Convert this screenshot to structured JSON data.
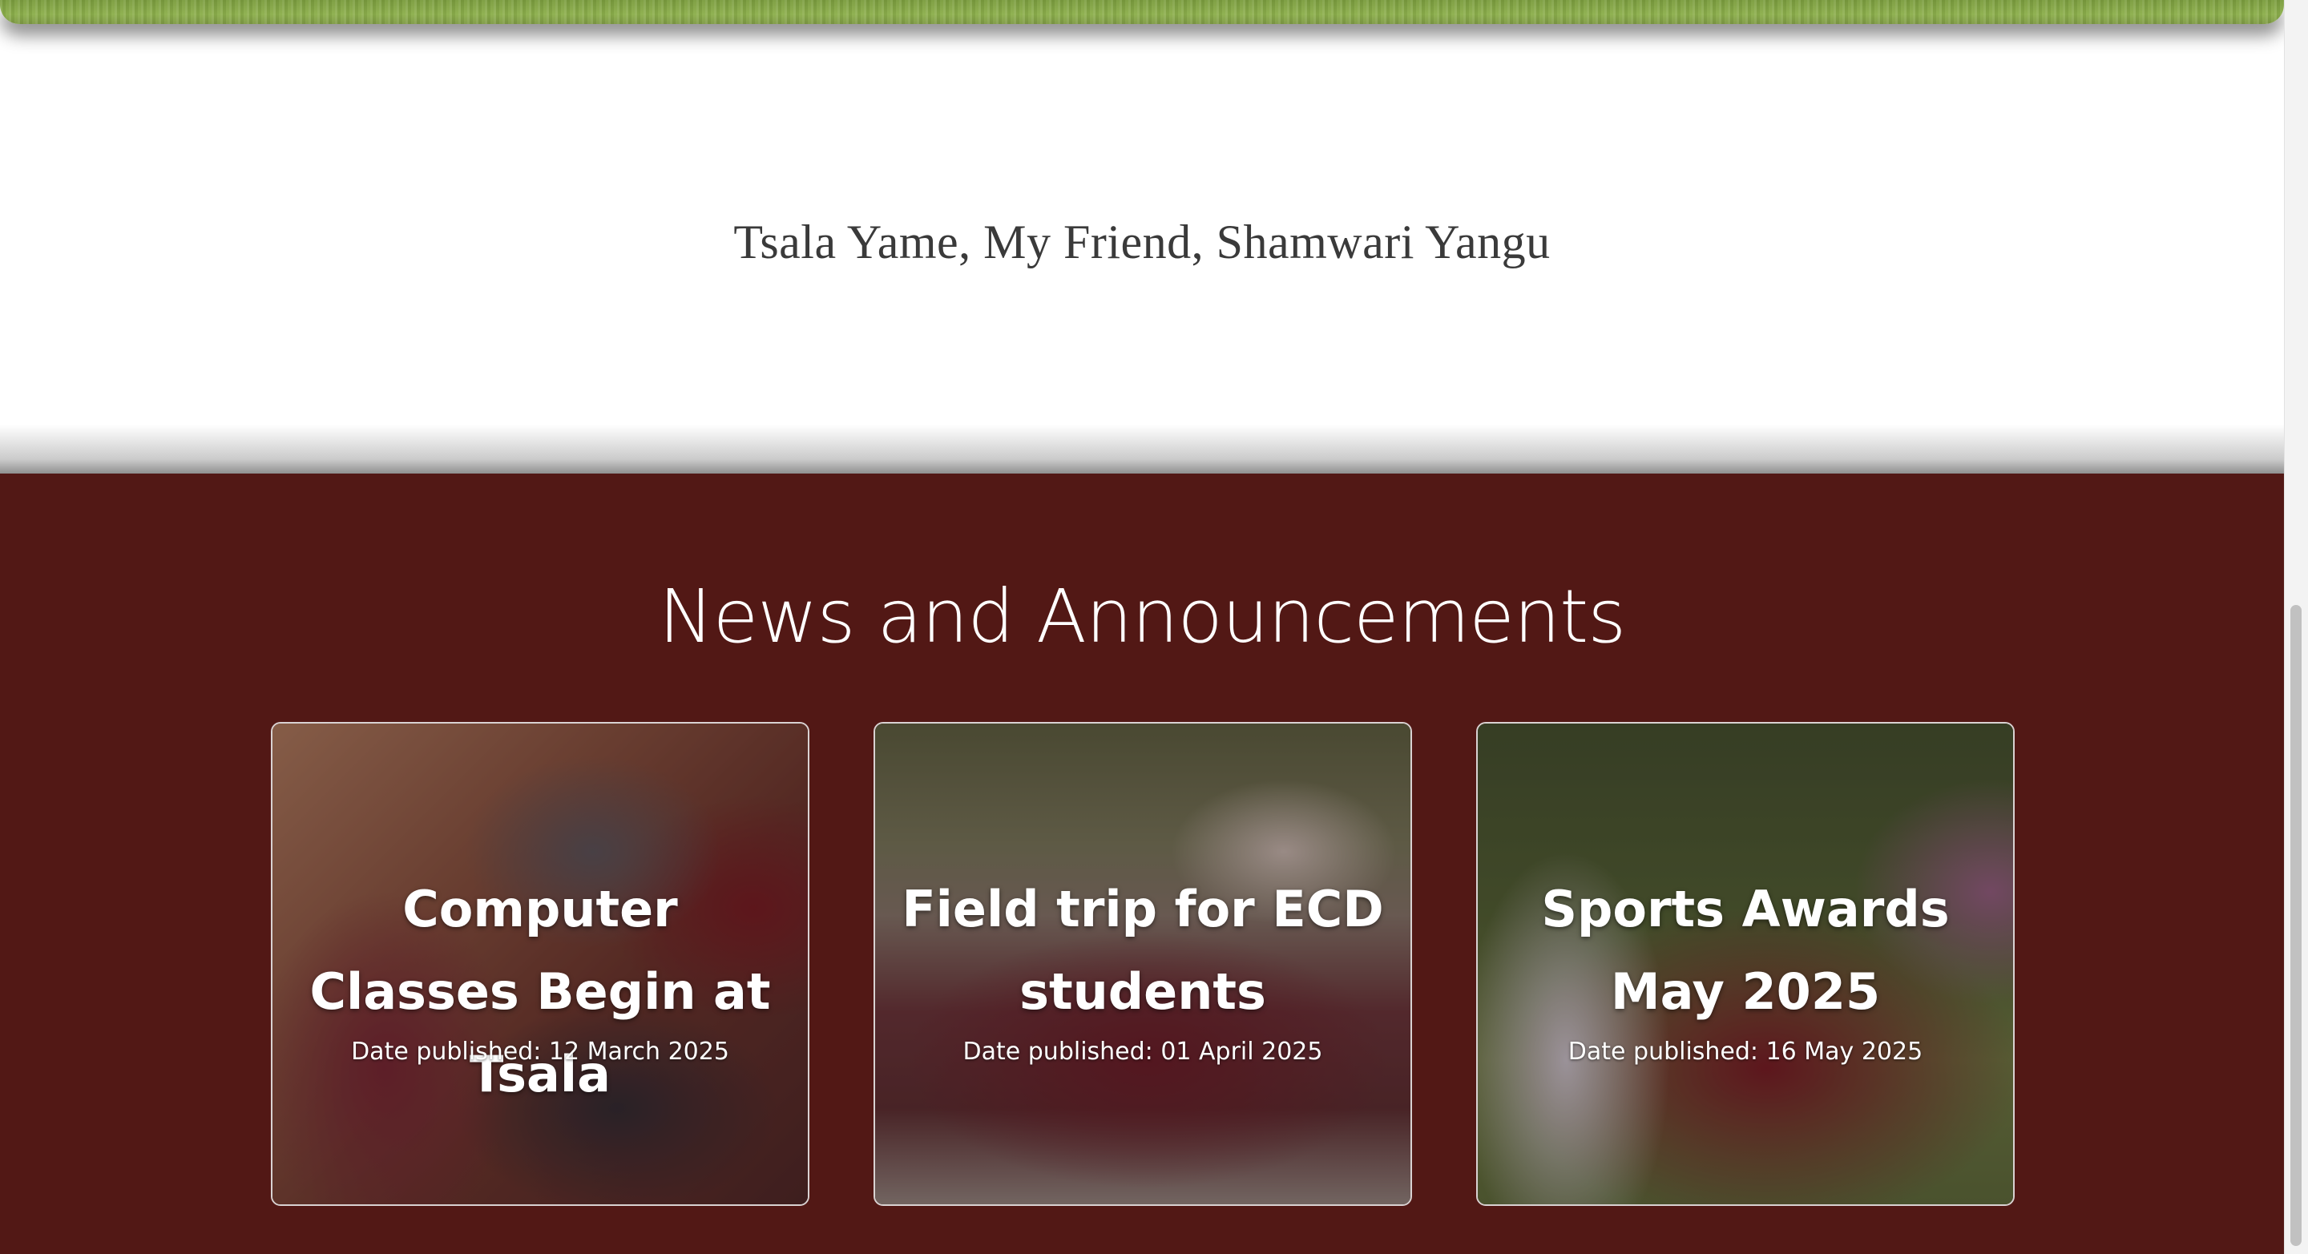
{
  "motto": {
    "text": "Tsala Yame, My Friend, Shamwari Yangu"
  },
  "news": {
    "heading": "News and Announcements",
    "items": [
      {
        "title": "Computer Classes Begin at Tsala",
        "date_label": "Date published:  12 March 2025"
      },
      {
        "title": "Field trip for ECD students",
        "date_label": "Date published:  01 April 2025"
      },
      {
        "title": "Sports Awards May 2025",
        "date_label": "Date published:  16 May 2025"
      }
    ]
  },
  "colors": {
    "news_background": "#521815",
    "motto_text": "#3a3a3a",
    "white": "#ffffff"
  }
}
